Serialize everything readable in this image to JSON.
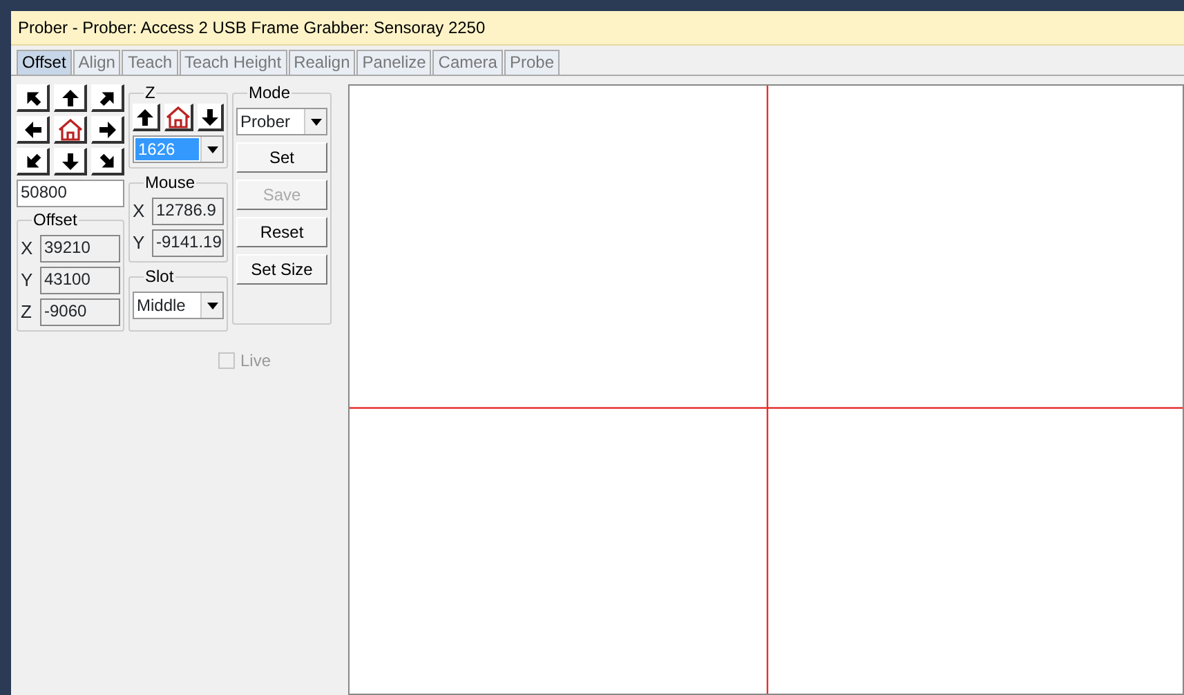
{
  "window": {
    "title": "Prober - Prober: Access 2 USB Frame Grabber: Sensoray 2250"
  },
  "tabs": [
    {
      "label": "Offset",
      "selected": true
    },
    {
      "label": "Align",
      "selected": false
    },
    {
      "label": "Teach",
      "selected": false
    },
    {
      "label": "Teach Height",
      "selected": false
    },
    {
      "label": "Realign",
      "selected": false
    },
    {
      "label": "Panelize",
      "selected": false
    },
    {
      "label": "Camera",
      "selected": false
    },
    {
      "label": "Probe",
      "selected": false
    }
  ],
  "jog": {
    "buttons": [
      {
        "kind": "nw"
      },
      {
        "kind": "n"
      },
      {
        "kind": "ne"
      },
      {
        "kind": "w"
      },
      {
        "kind": "home"
      },
      {
        "kind": "e"
      },
      {
        "kind": "sw"
      },
      {
        "kind": "s"
      },
      {
        "kind": "se"
      }
    ]
  },
  "step_field": {
    "value": "50800"
  },
  "offset": {
    "title": "Offset",
    "fields": [
      {
        "label": "X",
        "value": "39210"
      },
      {
        "label": "Y",
        "value": "43100"
      },
      {
        "label": "Z",
        "value": "-9060"
      }
    ]
  },
  "z": {
    "title": "Z",
    "buttons": [
      {
        "kind": "n"
      },
      {
        "kind": "home"
      },
      {
        "kind": "s"
      }
    ],
    "select": {
      "value": "1626",
      "selected": true
    }
  },
  "mouse": {
    "title": "Mouse",
    "fields": [
      {
        "label": "X",
        "value": "12786.9"
      },
      {
        "label": "Y",
        "value": "-9141.19"
      }
    ]
  },
  "slot": {
    "title": "Slot",
    "select": {
      "value": "Middle",
      "selected": false
    }
  },
  "mode": {
    "title": "Mode",
    "select": {
      "value": "Prober",
      "selected": false
    },
    "buttons": [
      {
        "label": "Set",
        "disabled": false
      },
      {
        "label": "Save",
        "disabled": true
      },
      {
        "label": "Reset",
        "disabled": false
      },
      {
        "label": "Set Size",
        "disabled": false
      }
    ]
  },
  "live": {
    "label": "Live",
    "checked": false,
    "disabled": true
  }
}
